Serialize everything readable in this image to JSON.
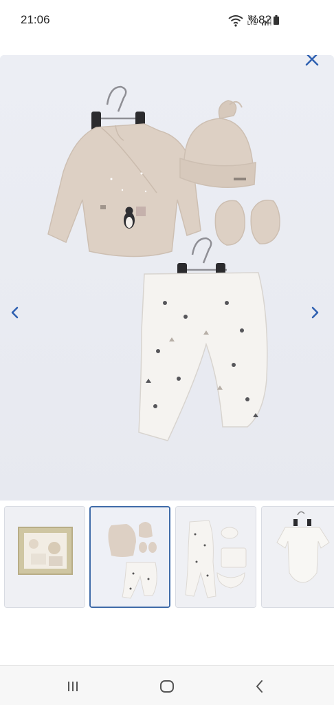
{
  "status_bar": {
    "time": "21:06",
    "network_line1": "Vo)",
    "network_line2": "LTE",
    "battery": "%82",
    "icons": [
      "wifi-icon",
      "signal-icon",
      "battery-icon"
    ]
  },
  "viewer": {
    "background": "#eef0f6",
    "close_icon": "close-icon",
    "prev_icon": "chevron-left-icon",
    "next_icon": "chevron-right-icon",
    "accent": "#2d5fb0"
  },
  "thumbnails": {
    "count": 4,
    "selected_index": 1,
    "items": [
      "gift-box-set",
      "wrap-top-hat-mittens-pants",
      "footed-romper-bib-set",
      "white-bodysuit"
    ]
  },
  "system_nav": {
    "icons": [
      "recent-apps-icon",
      "home-icon",
      "back-icon"
    ]
  }
}
